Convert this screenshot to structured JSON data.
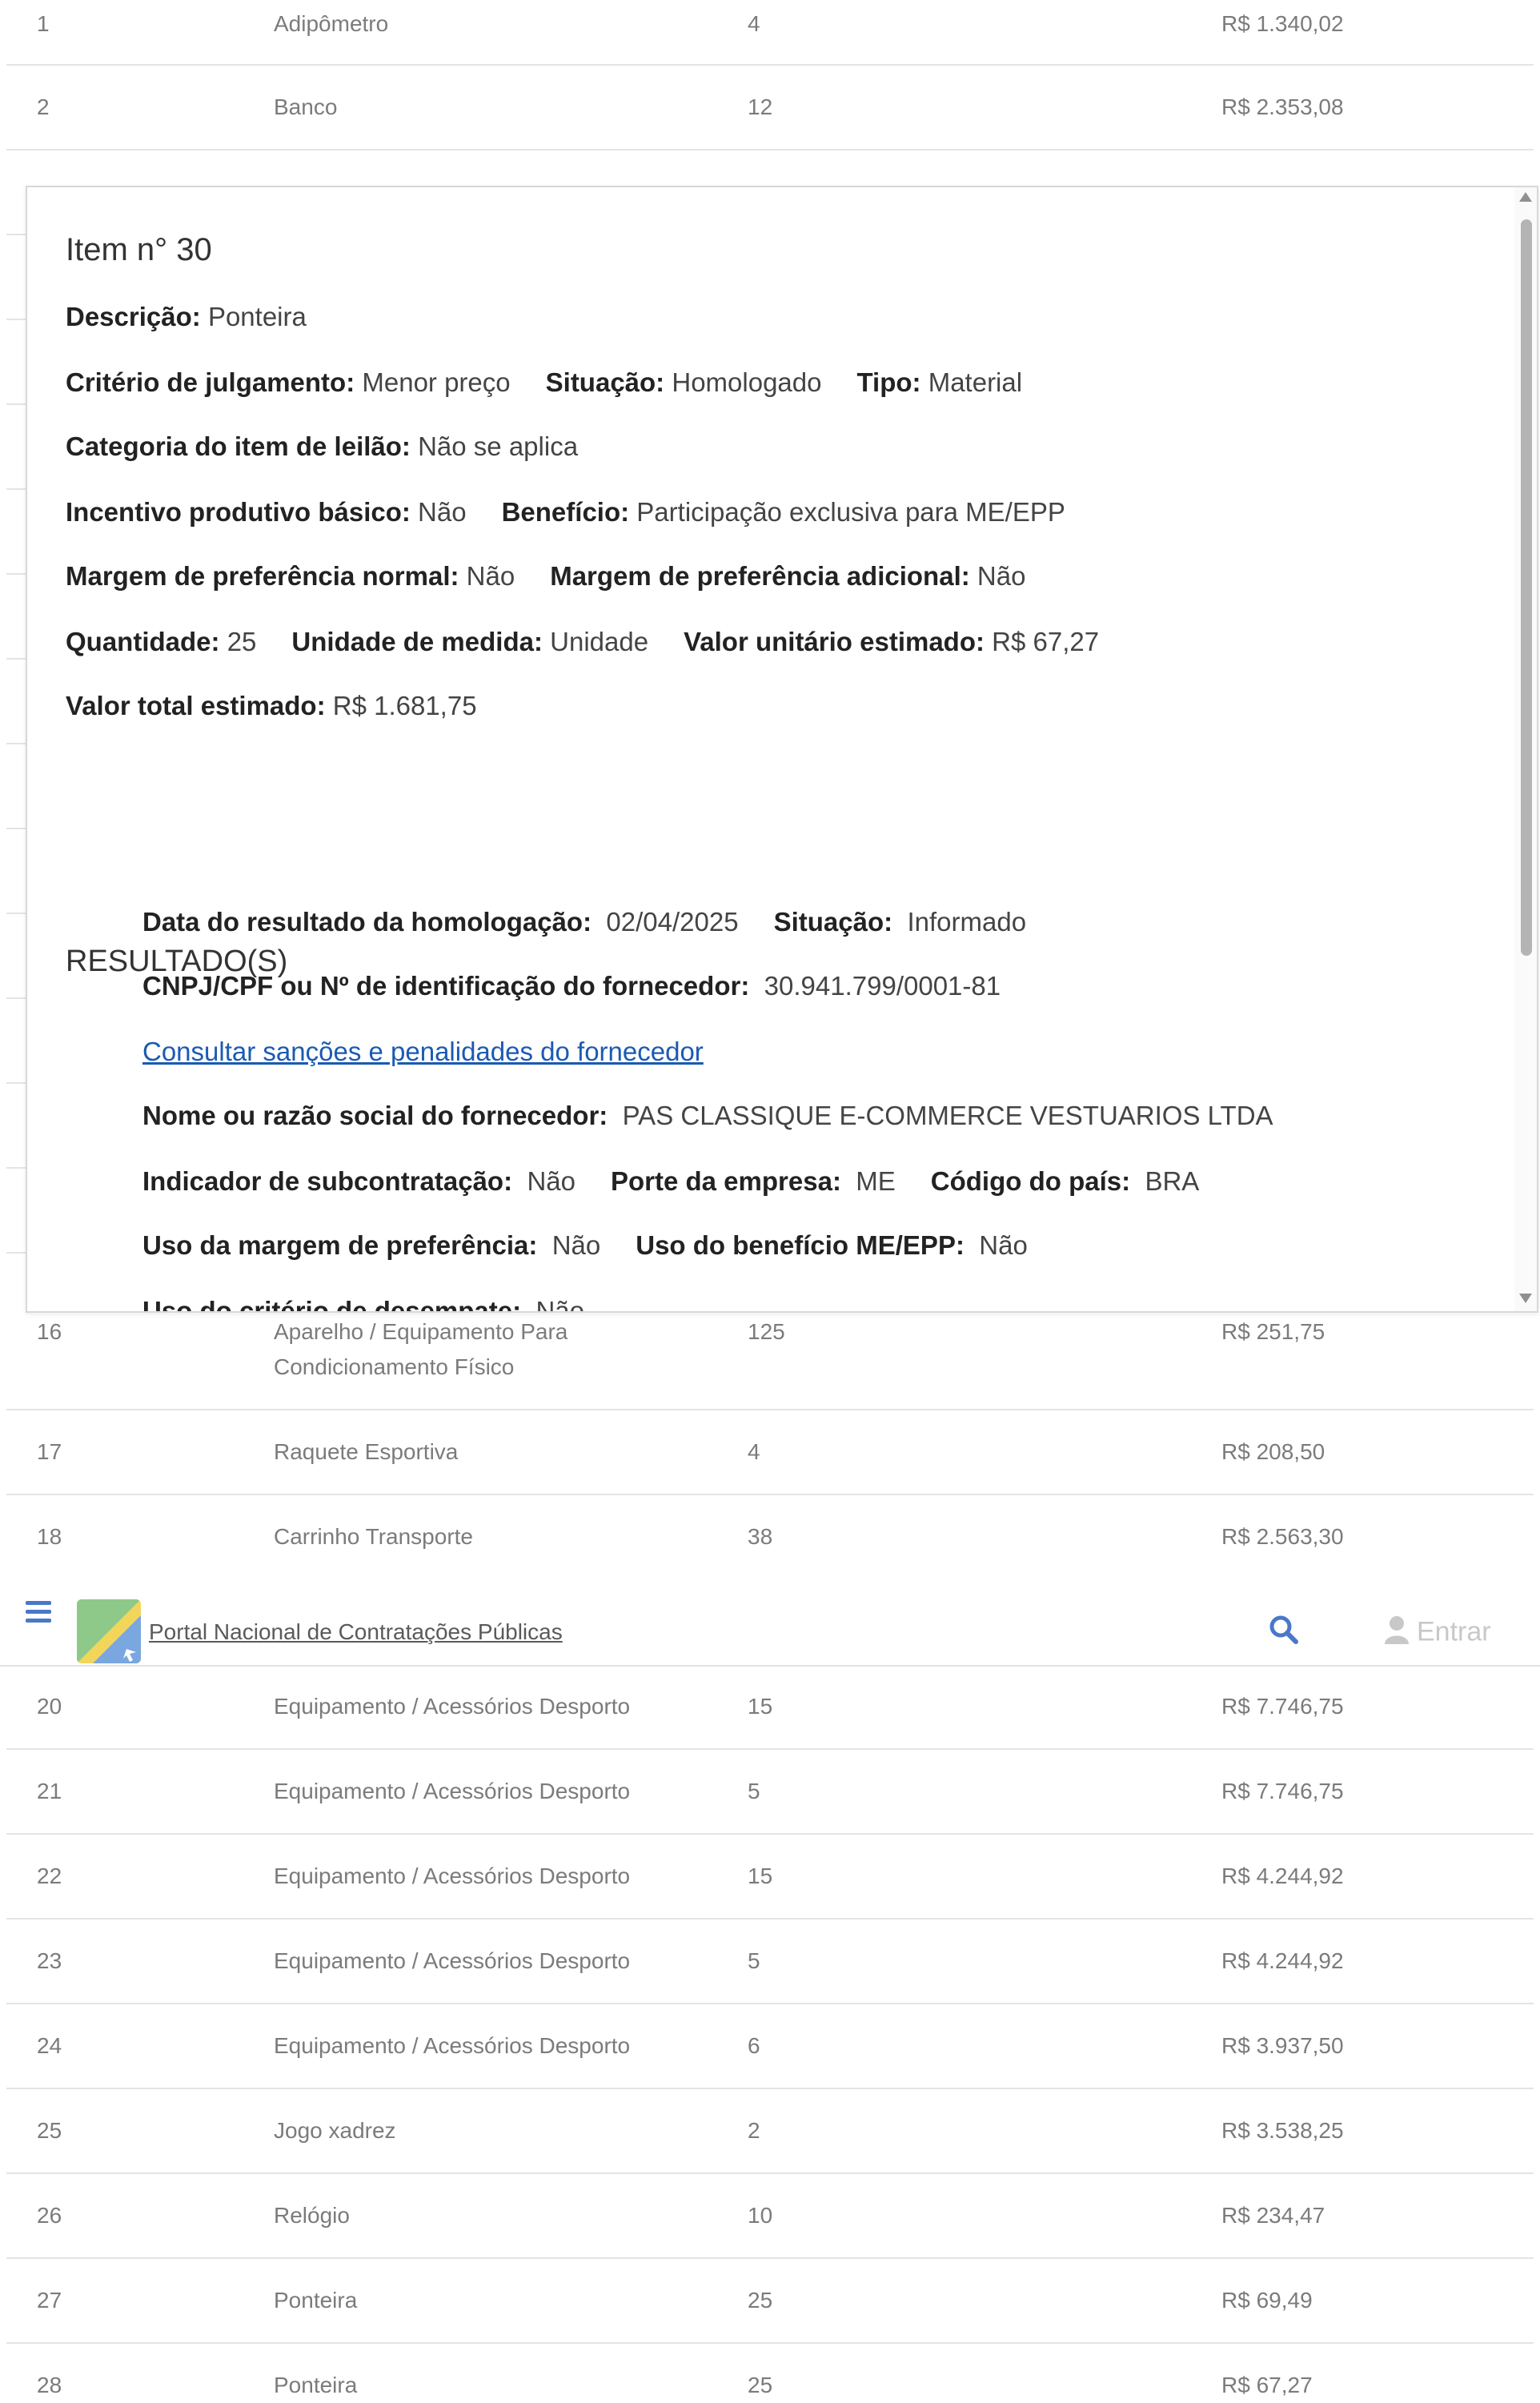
{
  "table": {
    "rows_top": [
      {
        "num": "1",
        "desc": "Adipômetro",
        "qty": "4",
        "value": "R$ 1.340,02"
      },
      {
        "num": "2",
        "desc": "Banco",
        "qty": "12",
        "value": "R$ 2.353,08"
      }
    ],
    "rows_mid": [
      {
        "num": "16",
        "desc": "Aparelho / Equipamento Para Condicionamento Físico",
        "qty": "125",
        "value": "R$ 251,75"
      },
      {
        "num": "17",
        "desc": "Raquete Esportiva",
        "qty": "4",
        "value": "R$ 208,50"
      },
      {
        "num": "18",
        "desc": "Carrinho Transporte",
        "qty": "38",
        "value": "R$ 2.563,30"
      }
    ],
    "rows_bottom": [
      {
        "num": "20",
        "desc": "Equipamento / Acessórios Desporto",
        "qty": "15",
        "value": "R$ 7.746,75"
      },
      {
        "num": "21",
        "desc": "Equipamento / Acessórios Desporto",
        "qty": "5",
        "value": "R$ 7.746,75"
      },
      {
        "num": "22",
        "desc": "Equipamento / Acessórios Desporto",
        "qty": "15",
        "value": "R$ 4.244,92"
      },
      {
        "num": "23",
        "desc": "Equipamento / Acessórios Desporto",
        "qty": "5",
        "value": "R$ 4.244,92"
      },
      {
        "num": "24",
        "desc": "Equipamento / Acessórios Desporto",
        "qty": "6",
        "value": "R$ 3.937,50"
      },
      {
        "num": "25",
        "desc": "Jogo xadrez",
        "qty": "2",
        "value": "R$ 3.538,25"
      },
      {
        "num": "26",
        "desc": "Relógio",
        "qty": "10",
        "value": "R$ 234,47"
      },
      {
        "num": "27",
        "desc": "Ponteira",
        "qty": "25",
        "value": "R$ 69,49"
      },
      {
        "num": "28",
        "desc": "Ponteira",
        "qty": "25",
        "value": "R$ 67,27"
      }
    ]
  },
  "header": {
    "portal_link": "Portal Nacional de Contratações Públicas",
    "login_label": "Entrar",
    "icons": [
      "menu-icon",
      "logo",
      "search-icon",
      "user-icon"
    ]
  },
  "modal": {
    "title": "Item n° 30",
    "descricao_label": "Descrição:",
    "descricao": "Ponteira",
    "criterio_label": "Critério de julgamento:",
    "criterio": "Menor preço",
    "situacao_label": "Situação:",
    "situacao": "Homologado",
    "tipo_label": "Tipo:",
    "tipo": "Material",
    "categoria_label": "Categoria do item de leilão:",
    "categoria": "Não se aplica",
    "incentivo_label": "Incentivo produtivo básico:",
    "incentivo": "Não",
    "beneficio_label": "Benefício:",
    "beneficio": "Participação exclusiva para ME/EPP",
    "margem_normal_label": "Margem de preferência normal:",
    "margem_normal": "Não",
    "margem_adicional_label": "Margem de preferência adicional:",
    "margem_adicional": "Não",
    "quantidade_label": "Quantidade:",
    "quantidade": "25",
    "unidade_label": "Unidade de medida:",
    "unidade": "Unidade",
    "valor_unitario_label": "Valor unitário estimado:",
    "valor_unitario": "R$ 67,27",
    "valor_total_label": "Valor total estimado:",
    "valor_total": "R$ 1.681,75",
    "resultados_title": "RESULTADO(S)",
    "resultado": {
      "data_label": "Data do resultado da homologação:",
      "data": "02/04/2025",
      "situacao_label": "Situação:",
      "situacao": "Informado",
      "cnpj_label": "CNPJ/CPF ou Nº de identificação do fornecedor:",
      "cnpj": "30.941.799/0001-81",
      "sancoes_link": "Consultar sanções e penalidades do fornecedor",
      "nome_label": "Nome ou razão social do fornecedor:",
      "nome": "PAS CLASSIQUE E-COMMERCE VESTUARIOS LTDA",
      "subcontratacao_label": "Indicador de subcontratação:",
      "subcontratacao": "Não",
      "porte_label": "Porte da empresa:",
      "porte": "ME",
      "pais_label": "Código do país:",
      "pais": "BRA",
      "uso_margem_label": "Uso da margem de preferência:",
      "uso_margem": "Não",
      "uso_beneficio_label": "Uso do benefício ME/EPP:",
      "uso_beneficio": "Não",
      "uso_criterio_label": "Uso do critério de desempate:",
      "uso_criterio": "Não"
    }
  },
  "colors": {
    "link": "#1b5ab3",
    "menu_icon": "#4a78c8",
    "row_text": "#7b7b7b"
  }
}
